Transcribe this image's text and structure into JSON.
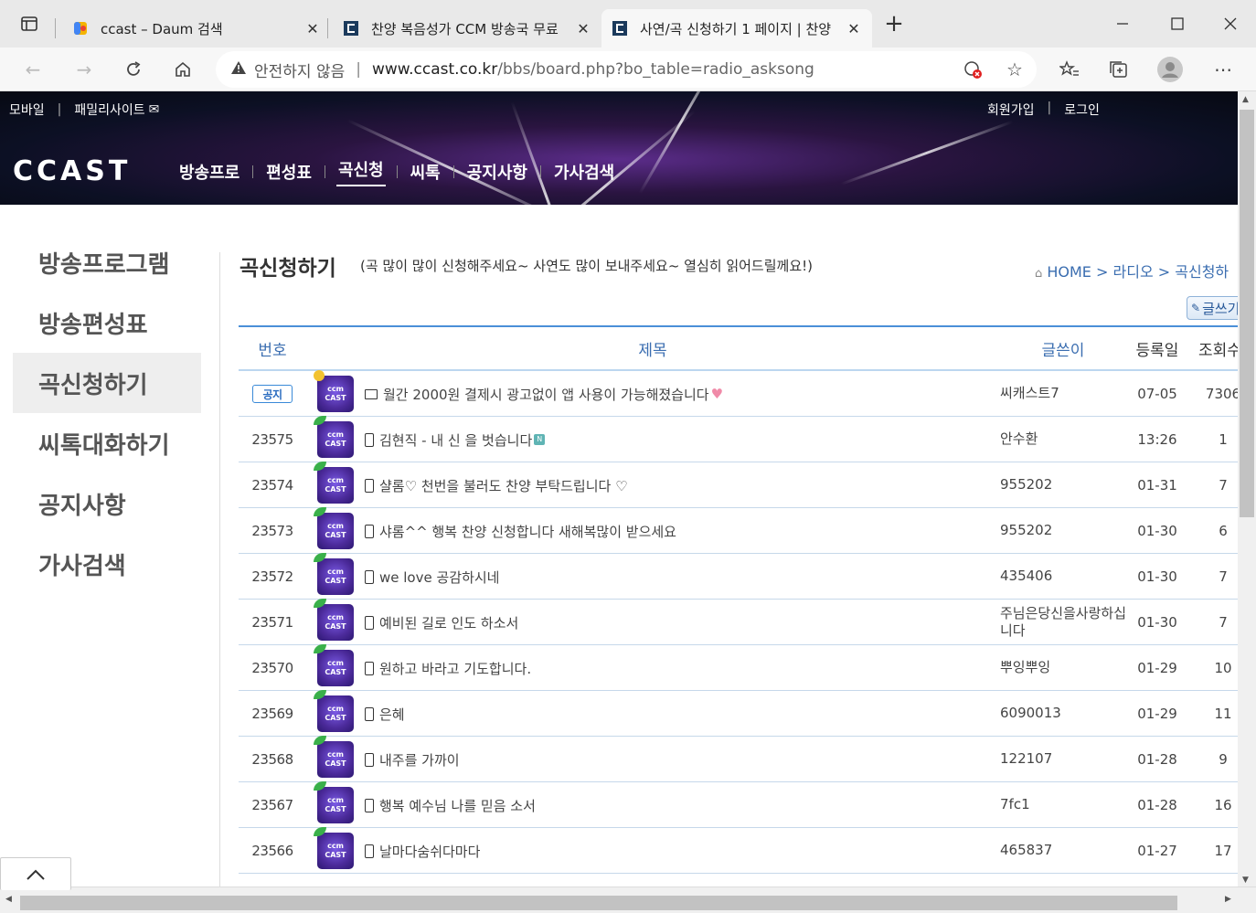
{
  "tabs": [
    {
      "title": "ccast – Daum 검색",
      "icon": "daum-favicon-icon"
    },
    {
      "title": "찬양 복음성가 CCM 방송국 무료",
      "icon": "ccast-favicon-icon"
    },
    {
      "title": "사연/곡 신청하기 1 페이지 | 찬양",
      "icon": "ccast-favicon-icon"
    }
  ],
  "new_tab": "+",
  "address": {
    "security": "안전하지 않음",
    "url_host": "www.ccast.co.kr",
    "url_path": "/bbs/board.php?bo_table=radio_asksong"
  },
  "site": {
    "top_left": [
      "모바일",
      "패밀리사이트"
    ],
    "top_right": [
      "회원가입",
      "로그인"
    ],
    "logo": "CCAST",
    "gnb": [
      "방송프로",
      "편성표",
      "곡신청",
      "씨톡",
      "공지사항",
      "가사검색"
    ],
    "gnb_active": "곡신청"
  },
  "lnb": [
    "방송프로그램",
    "방송편성표",
    "곡신청하기",
    "씨톡대화하기",
    "공지사항",
    "가사검색"
  ],
  "content": {
    "title": "곡신청하기",
    "subtitle": "(곡 많이 많이 신청해주세요~ 사연도 많이 보내주세요~ 열심히 읽어드릴께요!)",
    "breadcrumb": [
      "HOME",
      "라디오",
      "곡신청하"
    ],
    "write_button": "글쓰기"
  },
  "table": {
    "headers": [
      "번호",
      "제목",
      "글쓴이",
      "등록일",
      "조회수"
    ],
    "rows": [
      {
        "num": "공지",
        "subject": "월간 2000원 결제시 광고없이 앱 사용이 가능해졌습니다",
        "author": "씨캐스트7",
        "date": "07-05",
        "hits": "7306",
        "notice": true,
        "device": "monitor",
        "heart": true
      },
      {
        "num": "23575",
        "subject": "김현직 - 내 신 을 벗습니다",
        "author": "안수환",
        "date": "13:26",
        "hits": "1",
        "new": true
      },
      {
        "num": "23574",
        "subject": "샬롬♡ 천번을 불러도 찬양 부탁드립니다 ♡",
        "author": "955202",
        "date": "01-31",
        "hits": "7"
      },
      {
        "num": "23573",
        "subject": "샤롬^^ 행복 찬양 신청합니다 새해복많이 받으세요",
        "author": "955202",
        "date": "01-30",
        "hits": "6"
      },
      {
        "num": "23572",
        "subject": "we love 공감하시네",
        "author": "435406",
        "date": "01-30",
        "hits": "7"
      },
      {
        "num": "23571",
        "subject": "예비된 길로 인도 하소서",
        "author": "주님은당신을사랑하십니다",
        "date": "01-30",
        "hits": "7"
      },
      {
        "num": "23570",
        "subject": "원하고 바라고 기도합니다.",
        "author": "뿌잉뿌잉",
        "date": "01-29",
        "hits": "10"
      },
      {
        "num": "23569",
        "subject": "은혜",
        "author": "6090013",
        "date": "01-29",
        "hits": "11"
      },
      {
        "num": "23568",
        "subject": "내주를 가까이",
        "author": "122107",
        "date": "01-28",
        "hits": "9"
      },
      {
        "num": "23567",
        "subject": "행복 예수님 나를 믿음 소서",
        "author": "7fc1",
        "date": "01-28",
        "hits": "16"
      },
      {
        "num": "23566",
        "subject": "날마다숨쉬다마다",
        "author": "465837",
        "date": "01-27",
        "hits": "17"
      }
    ]
  },
  "thumb_text": [
    "ccm",
    "CAST"
  ],
  "colors": {
    "accent": "#3a6db0",
    "table_border": "#4a8fd8",
    "hero_bg": "#0c1024"
  }
}
